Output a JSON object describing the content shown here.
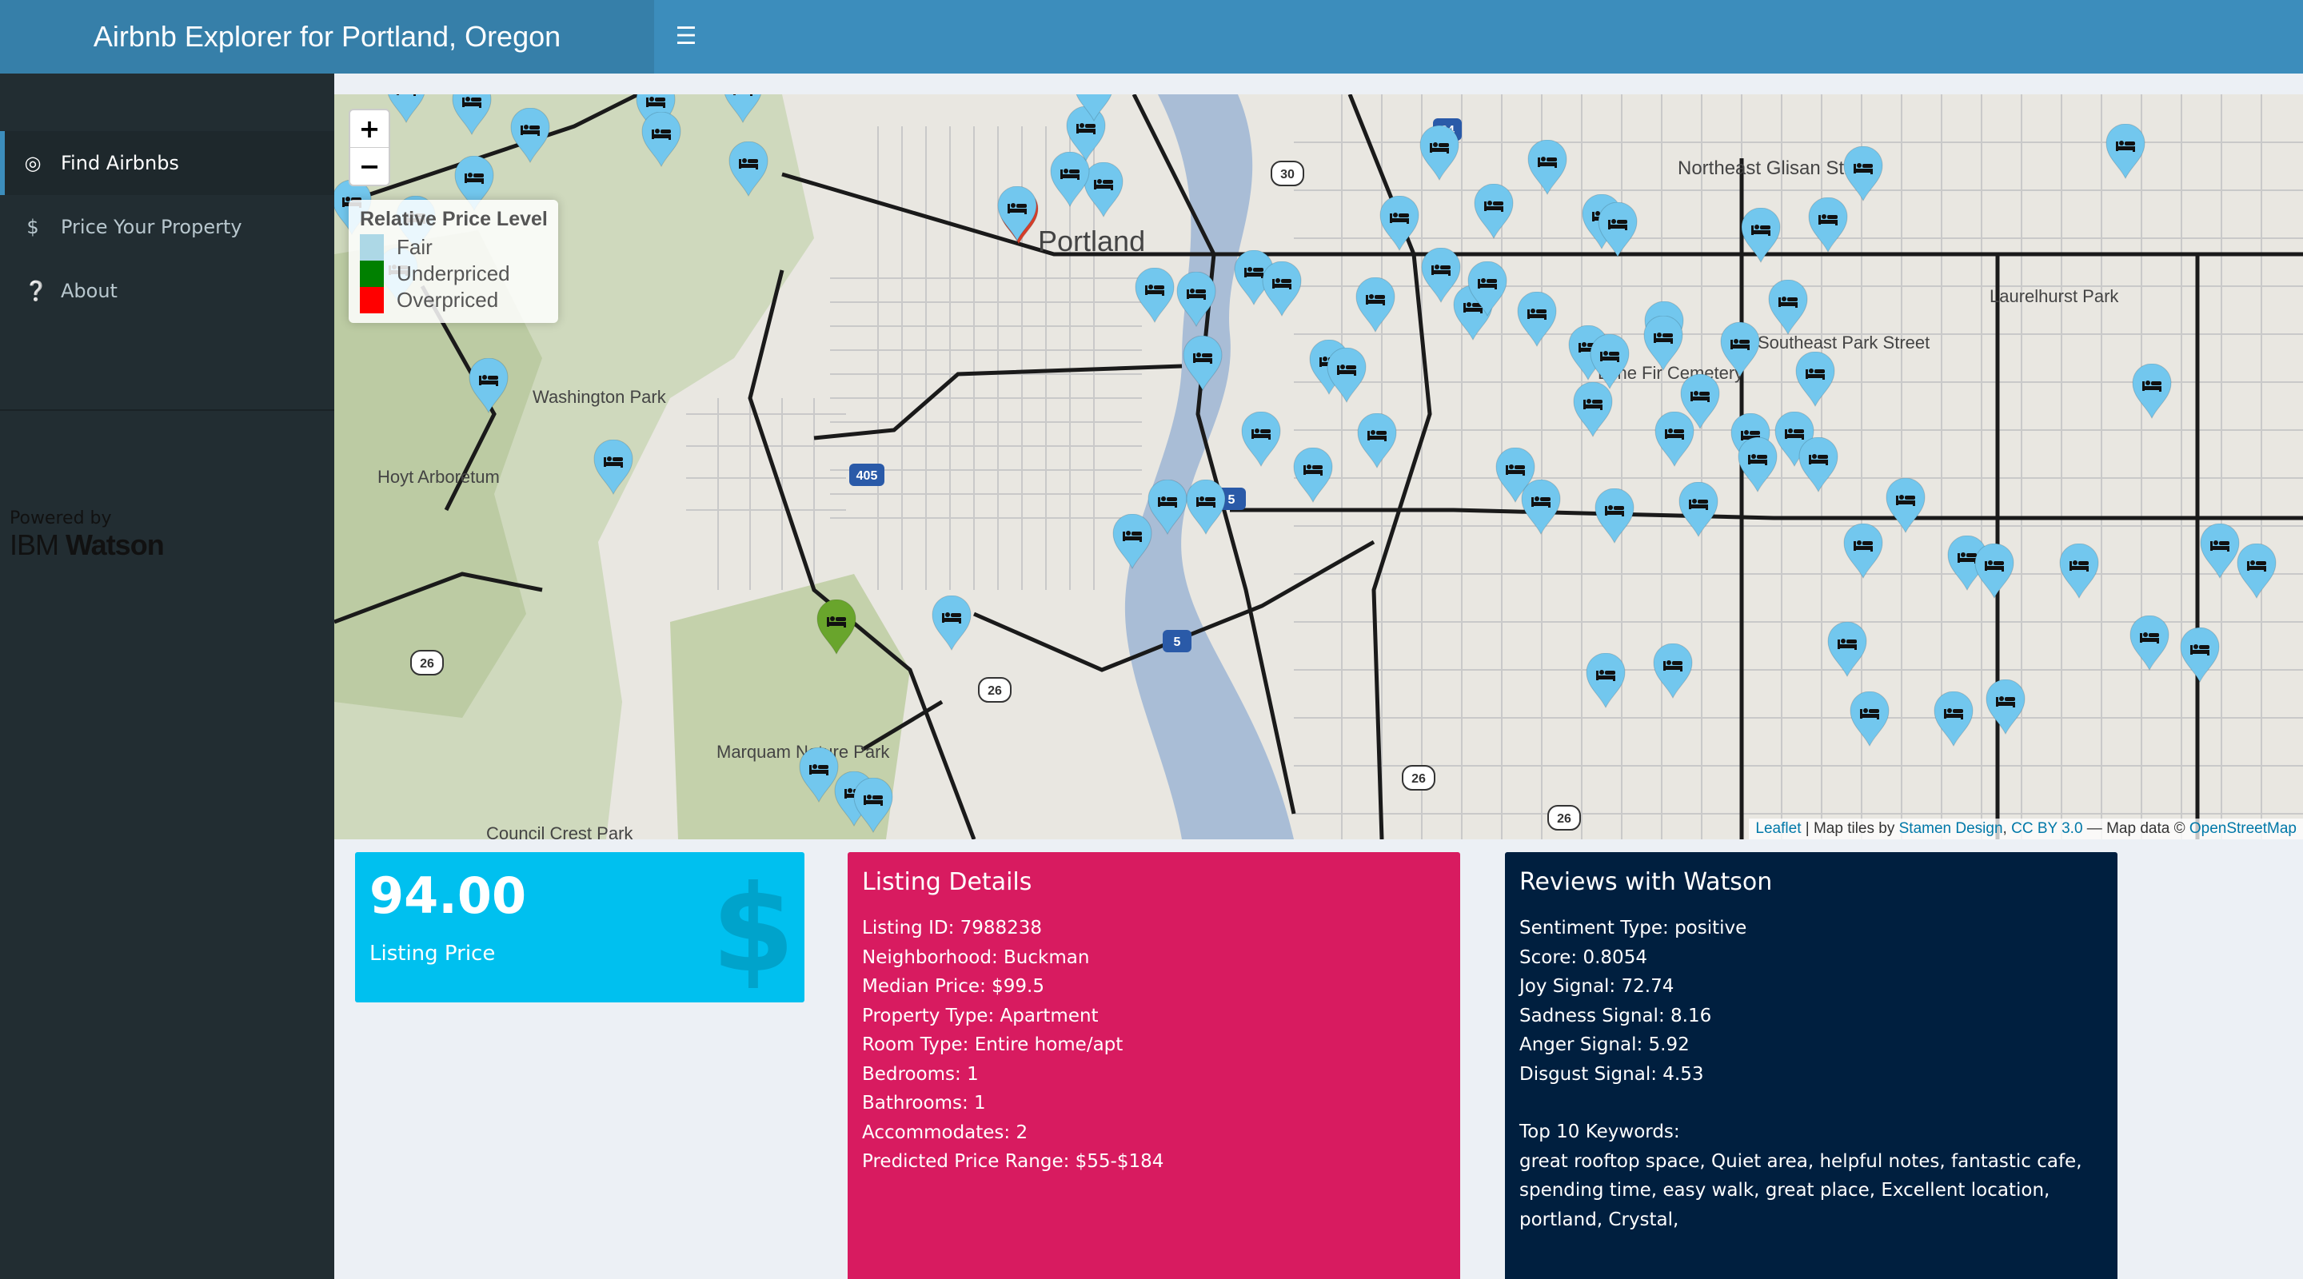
{
  "header": {
    "title": "Airbnb Explorer for Portland, Oregon",
    "menu_icon": "hamburger-icon"
  },
  "sidebar": {
    "items": [
      {
        "label": "Find Airbnbs",
        "icon": "target-icon",
        "active": true
      },
      {
        "label": "Price Your Property",
        "icon": "dollar-icon",
        "active": false
      },
      {
        "label": "About",
        "icon": "question-circle-icon",
        "active": false
      }
    ],
    "powered_by": "Powered by",
    "brand_ibm": "IBM",
    "brand_watson": "Watson"
  },
  "map": {
    "zoom_in": "+",
    "zoom_out": "−",
    "legend": {
      "title": "Relative Price Level",
      "items": [
        {
          "label": "Fair",
          "color": "#add8e6"
        },
        {
          "label": "Underpriced",
          "color": "#008000"
        },
        {
          "label": "Overpriced",
          "color": "#ff0000"
        }
      ]
    },
    "labels": {
      "portland": "Portland",
      "washington_park": "Washington Park",
      "hoyt": "Hoyt Arboretum",
      "glisan": "Northeast Glisan Street",
      "laurelhurst": "Laurelhurst Park",
      "lone_fir": "Lone Fir Cemetery",
      "southeast_park": "Southeast Park Street",
      "marquam": "Marquam Nature Park",
      "council_crest": "Council Crest Park"
    },
    "shields": {
      "i405": "405",
      "i5": "5",
      "i84": "84",
      "us26": "26",
      "us30": "30"
    },
    "attribution": {
      "leaflet": "Leaflet",
      "tiles_by": " | Map tiles by ",
      "stamen": "Stamen Design",
      "sep": ", ",
      "license": "CC BY 3.0",
      "data": " — Map data © ",
      "osm": "OpenStreetMap"
    },
    "pin_colors": {
      "fair": "#72c7ee",
      "under": "#69a52c",
      "over": "#d63e2a"
    },
    "pin_icon": "bed-icon"
  },
  "price_box": {
    "value": "94.00",
    "label": "Listing Price",
    "icon": "$"
  },
  "listing_details": {
    "title": "Listing Details",
    "lines": [
      "Listing ID: 7988238",
      "Neighborhood: Buckman",
      "Median Price: $99.5",
      "Property Type: Apartment",
      "Room Type: Entire home/apt",
      "Bedrooms: 1",
      "Bathrooms: 1",
      "Accommodates: 2",
      "Predicted Price Range: $55-$184"
    ]
  },
  "reviews": {
    "title": "Reviews with Watson",
    "lines": [
      "Sentiment Type: positive",
      "Score: 0.8054",
      "Joy Signal: 72.74",
      "Sadness Signal: 8.16",
      "Anger Signal: 5.92",
      "Disgust Signal: 4.53"
    ],
    "keywords_title": "Top 10 Keywords:",
    "keywords": "great rooftop space, Quiet area, helpful notes, fantastic cafe, spending time, easy walk, great place, Excellent location, portland, Crystal,"
  }
}
